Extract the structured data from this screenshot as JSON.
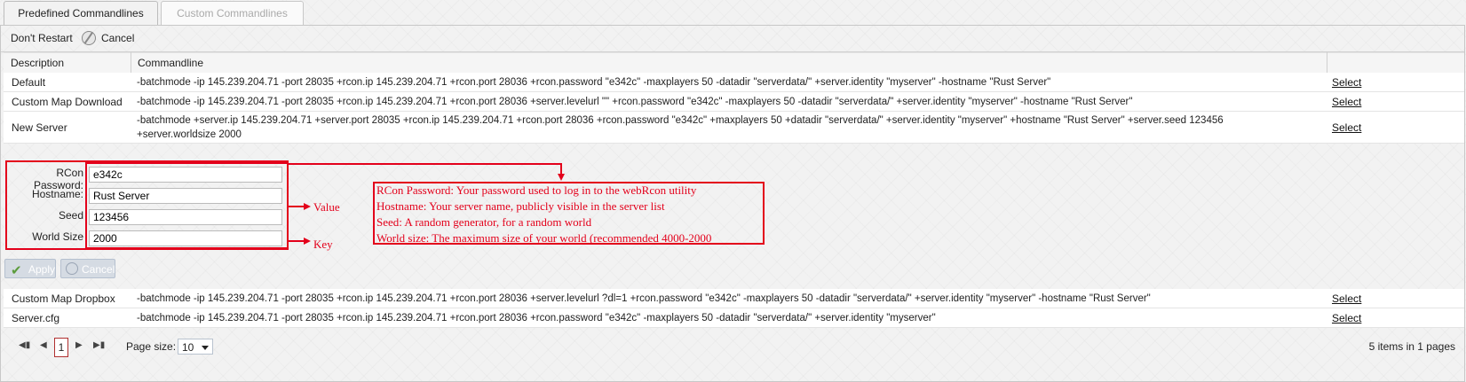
{
  "tabs": [
    {
      "label": "Predefined Commandlines"
    },
    {
      "label": "Custom Commandlines"
    }
  ],
  "toolbar": {
    "dont_restart": "Don't Restart",
    "cancel": "Cancel"
  },
  "grid": {
    "columns": [
      "Description",
      "Commandline"
    ],
    "rows": [
      {
        "description": "Default",
        "commandline": "-batchmode -ip 145.239.204.71 -port 28035 +rcon.ip 145.239.204.71 +rcon.port 28036 +rcon.password \"e342c\" -maxplayers 50 -datadir \"serverdata/\" +server.identity \"myserver\" -hostname \"Rust Server\"",
        "action": "Select"
      },
      {
        "description": "Custom Map Download",
        "commandline": "-batchmode -ip 145.239.204.71 -port 28035 +rcon.ip 145.239.204.71 +rcon.port 28036 +server.levelurl \"\" +rcon.password \"e342c\" -maxplayers 50 -datadir \"serverdata/\" +server.identity \"myserver\" -hostname \"Rust Server\"",
        "action": "Select"
      },
      {
        "description": "New Server",
        "commandline": "-batchmode +server.ip 145.239.204.71 +server.port 28035 +rcon.ip 145.239.204.71 +rcon.port 28036 +rcon.password \"e342c\" +maxplayers 50 +datadir \"serverdata/\" +server.identity \"myserver\" +hostname \"Rust Server\" +server.seed 123456 +server.worldsize 2000",
        "action": "Select"
      },
      {
        "description": "Custom Map Dropbox",
        "commandline": "-batchmode -ip 145.239.204.71 -port 28035 +rcon.ip 145.239.204.71 +rcon.port 28036 +server.levelurl ?dl=1 +rcon.password \"e342c\" -maxplayers 50 -datadir \"serverdata/\" +server.identity \"myserver\" -hostname \"Rust Server\"",
        "action": "Select"
      },
      {
        "description": "Server.cfg",
        "commandline": "-batchmode -ip 145.239.204.71 -port 28035 +rcon.ip 145.239.204.71 +rcon.port 28036 +rcon.password \"e342c\" -maxplayers 50 -datadir \"serverdata/\" +server.identity \"myserver\"",
        "action": "Select"
      }
    ]
  },
  "edit_form": {
    "fields": [
      {
        "label": "RCon Password:",
        "value": "e342c"
      },
      {
        "label": "Hostname:",
        "value": "Rust Server"
      },
      {
        "label": "Seed",
        "value": "123456"
      },
      {
        "label": "World Size",
        "value": "2000"
      }
    ],
    "apply": "Apply",
    "cancel": "Cancel"
  },
  "annotations": {
    "value_label": "Value",
    "key_label": "Key",
    "notes": [
      "RCon Password: Your password used to log in to the webRcon utility",
      "Hostname: Your server name, publicly visible in the server list",
      "Seed: A random generator, for a random world",
      "World size: The maximum size of your world (recommended 4000-2000"
    ],
    "color": "#e3001b"
  },
  "pager": {
    "current_page": "1",
    "page_size_label": "Page size:",
    "page_size": "10",
    "summary": "5 items in 1 pages"
  }
}
